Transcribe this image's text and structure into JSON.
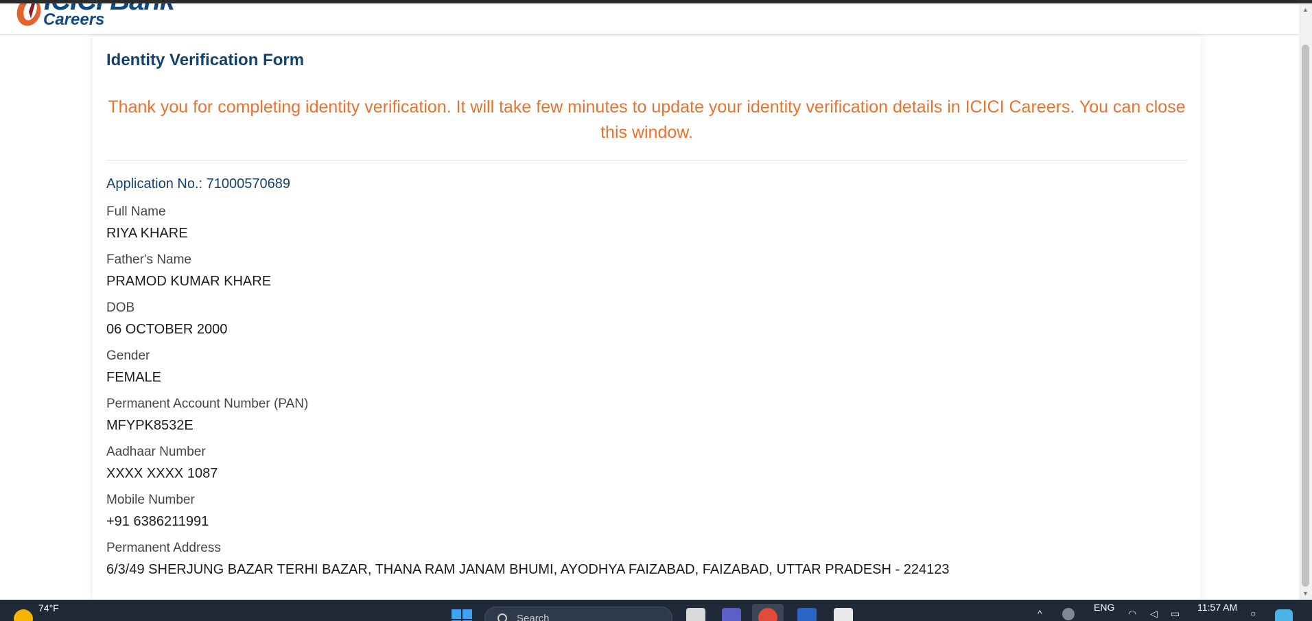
{
  "header": {
    "logo_text": "ICICI Bank",
    "logo_subtext": "Careers"
  },
  "form": {
    "title": "Identity Verification Form",
    "thank_you_message": "Thank you for completing identity verification. It will take few minutes to update your identity verification details in ICICI Careers. You can close this window.",
    "application_no": "Application No.: 71000570689",
    "fields": [
      {
        "label": "Full Name",
        "value": "RIYA KHARE"
      },
      {
        "label": "Father's Name",
        "value": "PRAMOD KUMAR KHARE"
      },
      {
        "label": "DOB",
        "value": "06 OCTOBER 2000"
      },
      {
        "label": "Gender",
        "value": "FEMALE"
      },
      {
        "label": "Permanent Account Number (PAN)",
        "value": "MFYPK8532E"
      },
      {
        "label": "Aadhaar Number",
        "value": "XXXX XXXX 1087"
      },
      {
        "label": "Mobile Number",
        "value": "+91 6386211991"
      },
      {
        "label": "Permanent Address",
        "value": "6/3/49 SHERJUNG BAZAR TERHI BAZAR, THANA RAM JANAM BHUMI, AYODHYA FAIZABAD, FAIZABAD, UTTAR PRADESH - 224123"
      }
    ]
  },
  "taskbar": {
    "weather_temp": "74°F",
    "search_placeholder": "Search",
    "language": "ENG",
    "time": "11:57 AM",
    "icons": [
      "weather-icon",
      "start-icon",
      "search-icon",
      "task-view-icon",
      "teams-icon",
      "chrome-icon",
      "word-icon",
      "app-icon",
      "chevron-up-icon",
      "network-icon",
      "wifi-icon",
      "volume-icon",
      "battery-icon",
      "notification-icon",
      "copilot-icon"
    ]
  },
  "colors": {
    "title_blue": "#14426b",
    "accent_orange": "#e8732f",
    "logo_blue": "#0d4a86",
    "logo_orange": "#e2632b",
    "taskbar": "#1f2937"
  }
}
